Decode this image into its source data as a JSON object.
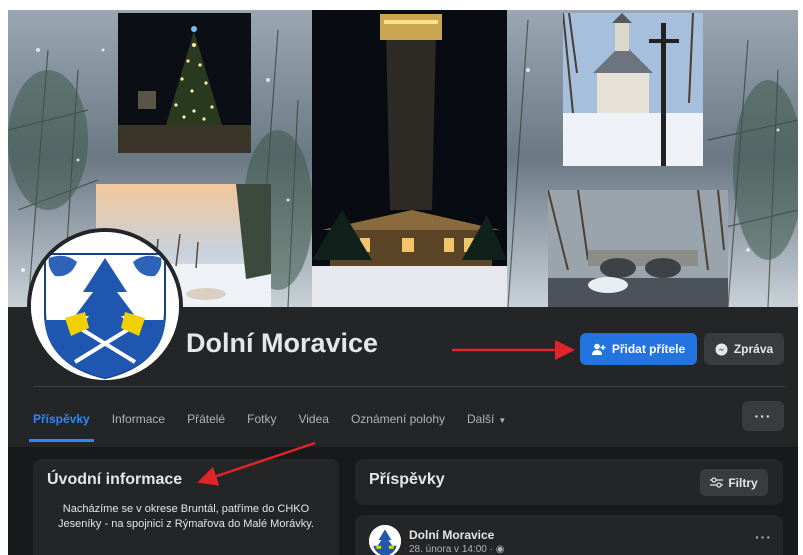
{
  "page": {
    "name": "Dolní Moravice"
  },
  "actions": {
    "add_friend_label": "Přidat přítele",
    "message_label": "Zpráva",
    "more_label": "···"
  },
  "tabs": [
    {
      "label": "Příspěvky",
      "active": true
    },
    {
      "label": "Informace"
    },
    {
      "label": "Přátelé"
    },
    {
      "label": "Fotky"
    },
    {
      "label": "Videa"
    },
    {
      "label": "Oznámení polohy"
    },
    {
      "label": "Další"
    }
  ],
  "intro": {
    "title": "Úvodní informace",
    "text": "Nacházíme se v okrese Bruntál, patříme do CHKO Jeseníky - na spojnici z Rýmařova do Malé Morávky."
  },
  "posts": {
    "title": "Příspěvky",
    "filter_label": "Filtry",
    "first_post": {
      "author": "Dolní Moravice",
      "meta": "28. února v 14:00 ·",
      "more_label": "···"
    }
  },
  "colors": {
    "accent": "#2374e1",
    "annotation_arrow": "#e0242a",
    "dark_surface": "#242526"
  }
}
